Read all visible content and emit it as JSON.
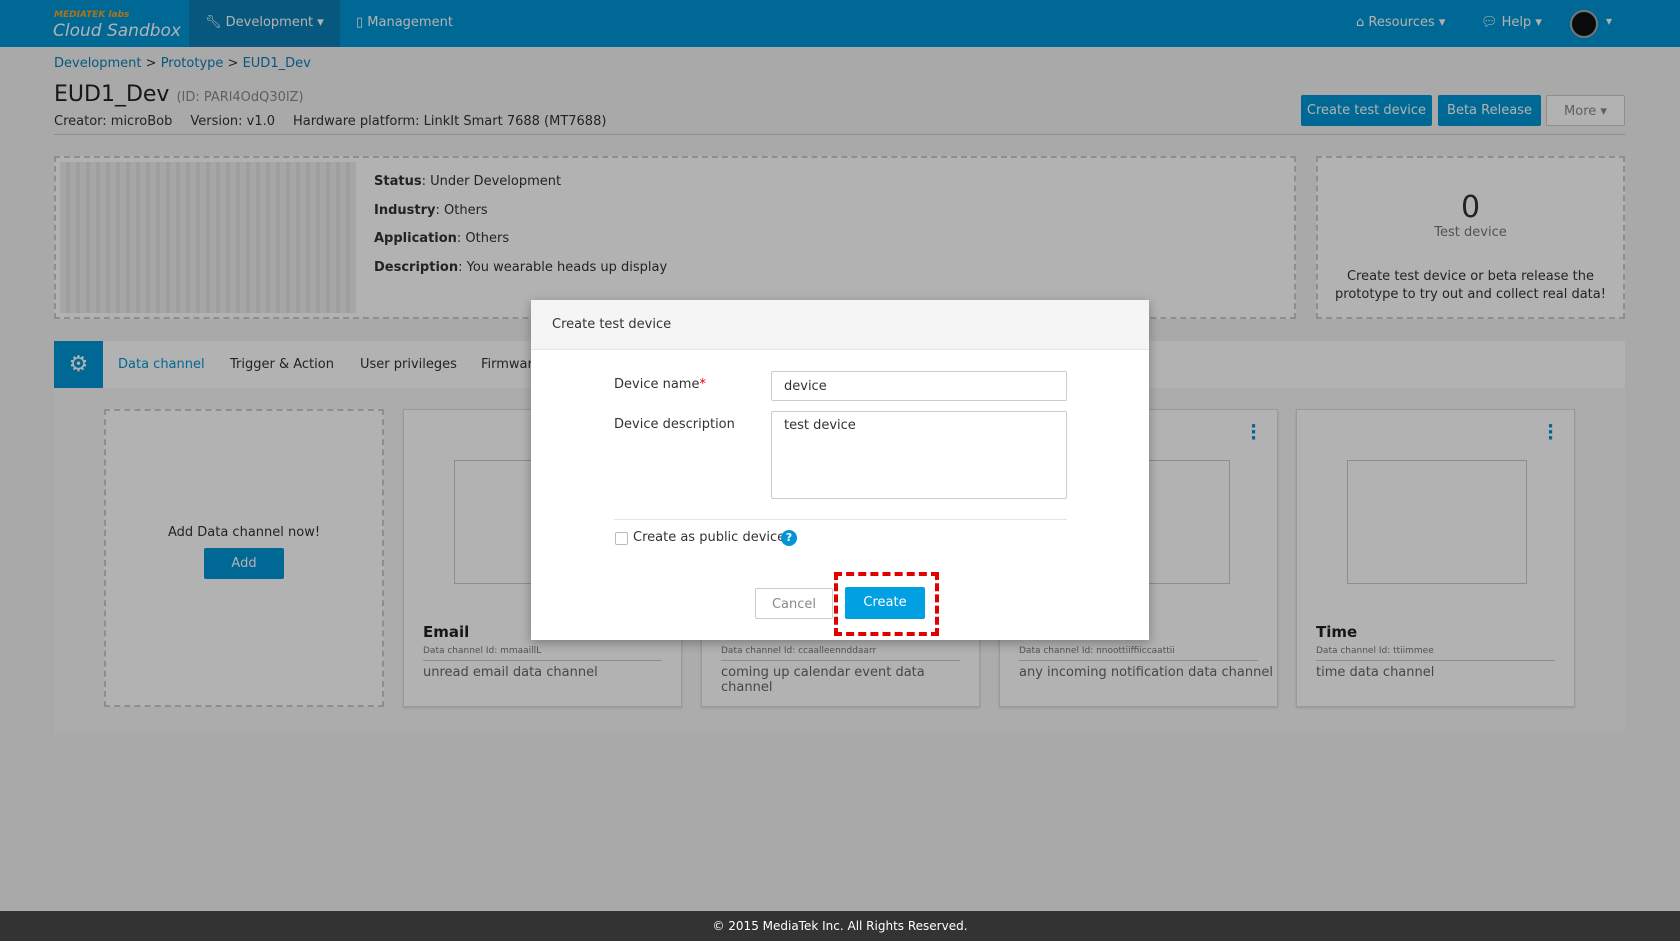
{
  "header": {
    "brand_top": "MEDIATEK labs",
    "brand": "Cloud Sandbox",
    "nav": [
      {
        "label": "Development",
        "icon": "wrench-icon"
      },
      {
        "label": "Management",
        "icon": "document-icon"
      }
    ],
    "resources": "Resources",
    "help": "Help"
  },
  "breadcrumb": [
    "Development",
    "Prototype",
    "EUD1_Dev"
  ],
  "title": "EUD1_Dev",
  "id_text": "(ID: PARl4OdQ30lZ)",
  "meta": {
    "creator": "Creator: microBob",
    "version": "Version: v1.0",
    "platform": "Hardware platform: LinkIt Smart 7688 (MT7688)"
  },
  "actions": {
    "create_test": "Create test device",
    "beta": "Beta Release",
    "more": "More"
  },
  "info": {
    "status_k": "Status",
    "status_v": ": Under Development",
    "industry_k": "Industry",
    "industry_v": ": Others",
    "app_k": "Application",
    "app_v": ": Others",
    "desc_k": "Description",
    "desc_v": ": You wearable heads up display"
  },
  "test_device": {
    "count": "0",
    "label": "Test device",
    "hint1": "Create test device or beta release the",
    "hint2": "prototype to try out and collect real data!"
  },
  "tabs": [
    "Data channel",
    "Trigger & Action",
    "User privileges",
    "Firmware"
  ],
  "add_card": {
    "text": "Add Data channel now!",
    "button": "Add"
  },
  "cards": [
    {
      "name": "Email",
      "id": "Data channel Id: mmaaillL",
      "desc": "unread email data channel"
    },
    {
      "name": "",
      "id": "Data channel Id: ccaalleennddaarr",
      "desc": "coming up calendar event data channel"
    },
    {
      "name": "",
      "id": "Data channel Id: nnoottiiffiiccaattii",
      "desc": "any incoming notification data channel"
    },
    {
      "name": "Time",
      "id": "Data channel Id: ttiimmee",
      "desc": "time data channel"
    }
  ],
  "modal": {
    "title": "Create test device",
    "name_label": "Device name",
    "required": "*",
    "name_value": "device",
    "desc_label": "Device description",
    "desc_value": "test device",
    "public_label": "Create as public device",
    "cancel": "Cancel",
    "create": "Create"
  },
  "footer": "© 2015 MediaTek Inc. All Rights Reserved.",
  "colors": {
    "primary": "#0095d6",
    "highlight": "#e00000"
  }
}
